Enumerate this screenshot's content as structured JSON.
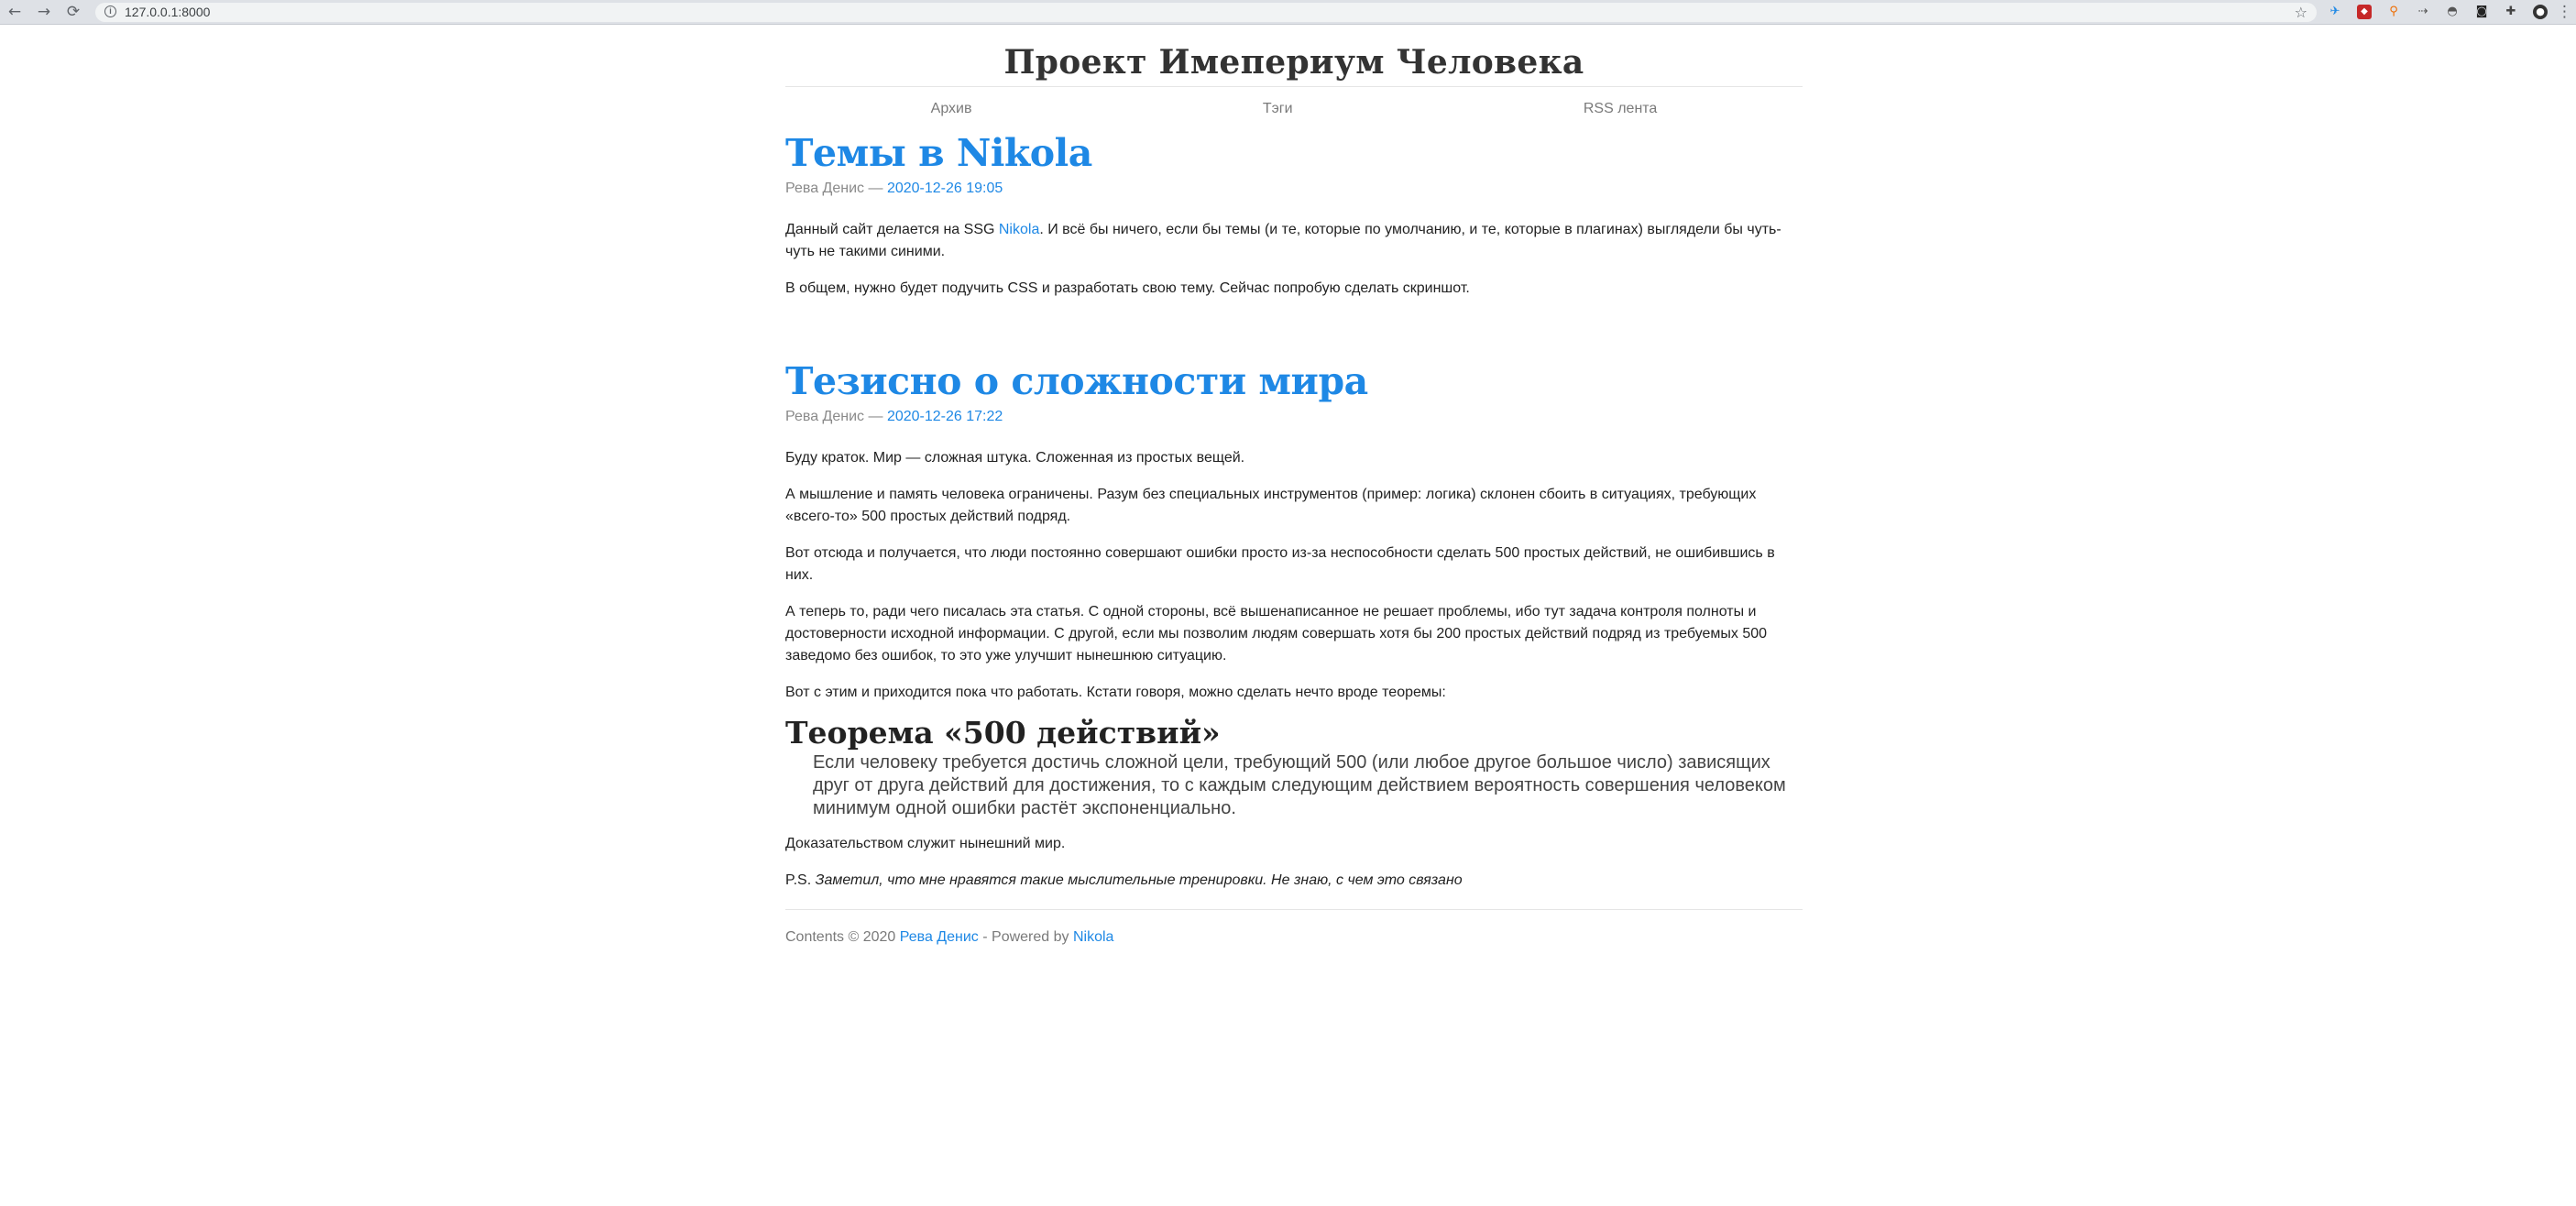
{
  "browser": {
    "url": "127.0.0.1:8000",
    "back_icon": "←",
    "forward_icon": "→",
    "reload_icon": "⟳",
    "star_icon": "☆",
    "info_icon": "i",
    "menu_icon": "⋮"
  },
  "site": {
    "title": "Проект Имепериум Человека"
  },
  "nav": {
    "archive": "Архив",
    "tags": "Тэги",
    "rss": "RSS лента"
  },
  "posts": [
    {
      "title": "Темы в Nikola",
      "author": "Рева Денис",
      "sep": " — ",
      "date": "2020-12-26 19:05",
      "p1_before": "Данный сайт делается на SSG ",
      "p1_link": "Nikola",
      "p1_after": ". И всё бы ничего, если бы темы (и те, которые по умолчанию, и те, которые в плагинах) выглядели бы чуть-чуть не такими синими.",
      "p2": "В общем, нужно будет подучить CSS и разработать свою тему. Сейчас попробую сделать скриншот."
    },
    {
      "title": "Тезисно о сложности мира",
      "author": "Рева Денис",
      "sep": " — ",
      "date": "2020-12-26 17:22",
      "p1": "Буду краток. Мир — сложная штука. Сложенная из простых вещей.",
      "p2": "А мышление и память человека ограничены. Разум без специальных инструментов (пример: логика) склонен сбоить в ситуациях, требующих «всего-то» 500 простых действий подряд.",
      "p3": "Вот отсюда и получается, что люди постоянно совершают ошибки просто из-за неспособности сделать 500 простых действий, не ошибившись в них.",
      "p4": "А теперь то, ради чего писалась эта статья. С одной стороны, всё вышенаписанное не решает проблемы, ибо тут задача контроля полноты и достоверности исходной информации. С другой, если мы позволим людям совершать хотя бы 200 простых действий подряд из требуемых 500 заведомо без ошибок, то это уже улучшит нынешнюю ситуацию.",
      "p5": "Вот с этим и приходится пока что работать. Кстати говоря, можно сделать нечто вроде теоремы:",
      "theorem_title": "Теорема «500 действий»",
      "quote": "Если человеку требуется достичь сложной цели, требующий 500 (или любое другое большое число) зависящих друг от друга действий для достижения, то с каждым следующим действием вероятность совершения человеком минимум одной ошибки растёт экспоненциально.",
      "p6": "Доказательством служит нынешний мир.",
      "ps_prefix": "P.S. ",
      "ps_text": "Заметил, что мне нравятся такие мыслительные тренировки. Не знаю, с чем это связано"
    }
  ],
  "footer": {
    "prefix": "Contents © 2020 ",
    "author": "Рева Денис",
    "middle": " - Powered by ",
    "engine": "Nikola"
  }
}
